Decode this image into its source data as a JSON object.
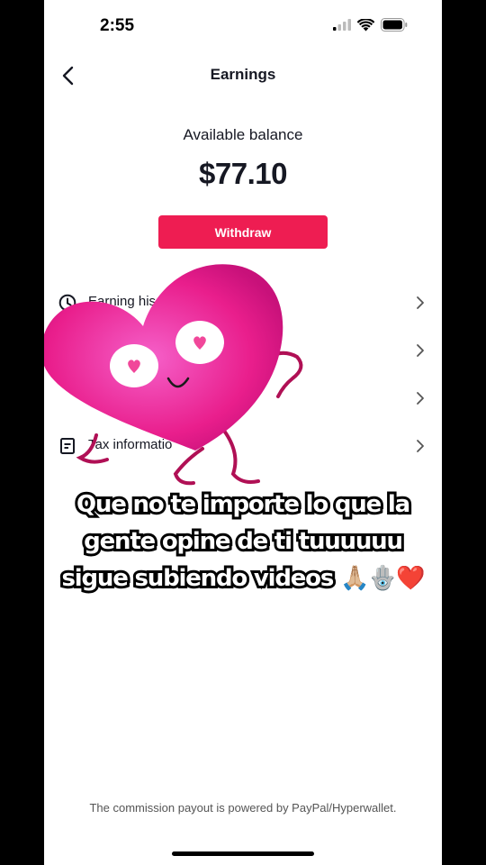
{
  "status_bar": {
    "time": "2:55"
  },
  "header": {
    "title": "Earnings"
  },
  "balance": {
    "label": "Available balance",
    "amount": "$77.10",
    "withdraw_label": "Withdraw"
  },
  "menu": {
    "items": [
      {
        "label": "Earning his",
        "icon": "clock-icon"
      },
      {
        "label": "",
        "icon": ""
      },
      {
        "label": "",
        "icon": ""
      },
      {
        "label": "Tax informatio",
        "icon": "document-icon"
      }
    ]
  },
  "caption": {
    "lines": [
      "Que no te importe lo que la",
      "gente opine de ti tuuuuuu",
      "sigue subiendo videos 🙏🏼🪬❤️"
    ]
  },
  "footer": {
    "note": "The commission payout is powered by PayPal/Hyperwallet."
  },
  "colors": {
    "accent": "#ee1d52",
    "heart": "#e91e8c"
  }
}
